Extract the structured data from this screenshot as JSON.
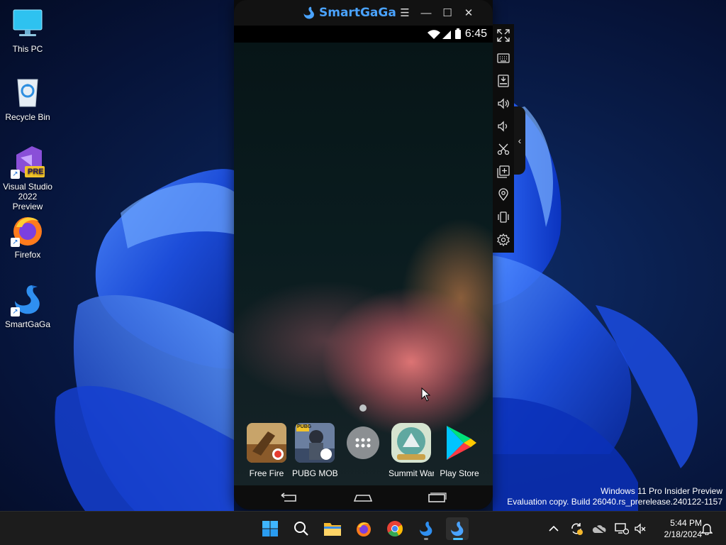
{
  "desktop": {
    "icons": [
      {
        "label": "This PC",
        "icon": "monitor-icon"
      },
      {
        "label": "Recycle Bin",
        "icon": "recycle-bin-icon"
      },
      {
        "label": "Visual Studio 2022 Preview",
        "icon": "visual-studio-icon",
        "badge": "PRE"
      },
      {
        "label": "Firefox",
        "icon": "firefox-icon"
      },
      {
        "label": "SmartGaGa",
        "icon": "smartgaga-swan-icon"
      }
    ],
    "shortcut_arrow": "↗"
  },
  "emulator": {
    "brand": "SmartGaGa",
    "controls": {
      "menu": "☰",
      "minimize": "—",
      "maximize": "☐",
      "close": "✕"
    },
    "status_time": "6:45",
    "dock": [
      {
        "label": "Free Fire",
        "icon": "free-fire-icon"
      },
      {
        "label": "PUBG MOBILE",
        "icon": "pubg-icon",
        "badge": "PUBG"
      },
      {
        "label": "",
        "icon": "app-drawer-icon"
      },
      {
        "label": "Summit Wars",
        "icon": "summit-icon"
      },
      {
        "label": "Play Store",
        "icon": "play-store-icon"
      }
    ],
    "sidebar_tools": [
      "fullscreen-icon",
      "keyboard-icon",
      "install-apk-icon",
      "volume-up-icon",
      "volume-down-icon",
      "screenshot-scissors-icon",
      "multi-instance-icon",
      "location-icon",
      "shake-icon",
      "settings-icon"
    ],
    "collapse_glyph": "‹"
  },
  "watermark": {
    "line1": "Windows 11 Pro Insider Preview",
    "line2": "Evaluation copy. Build 26040.rs_prerelease.240122-1157"
  },
  "taskbar": {
    "apps": [
      "windows-start-icon",
      "search-icon",
      "file-explorer-icon",
      "firefox-icon",
      "chrome-icon",
      "smartgaga-icon",
      "smartgaga-active-icon"
    ],
    "clock_time": "5:44 PM",
    "clock_date": "2/18/2024"
  },
  "colors": {
    "accent": "#4cc2ff",
    "brand_blue": "#4aa3ff",
    "taskbar_bg": "#1c1c1c"
  }
}
